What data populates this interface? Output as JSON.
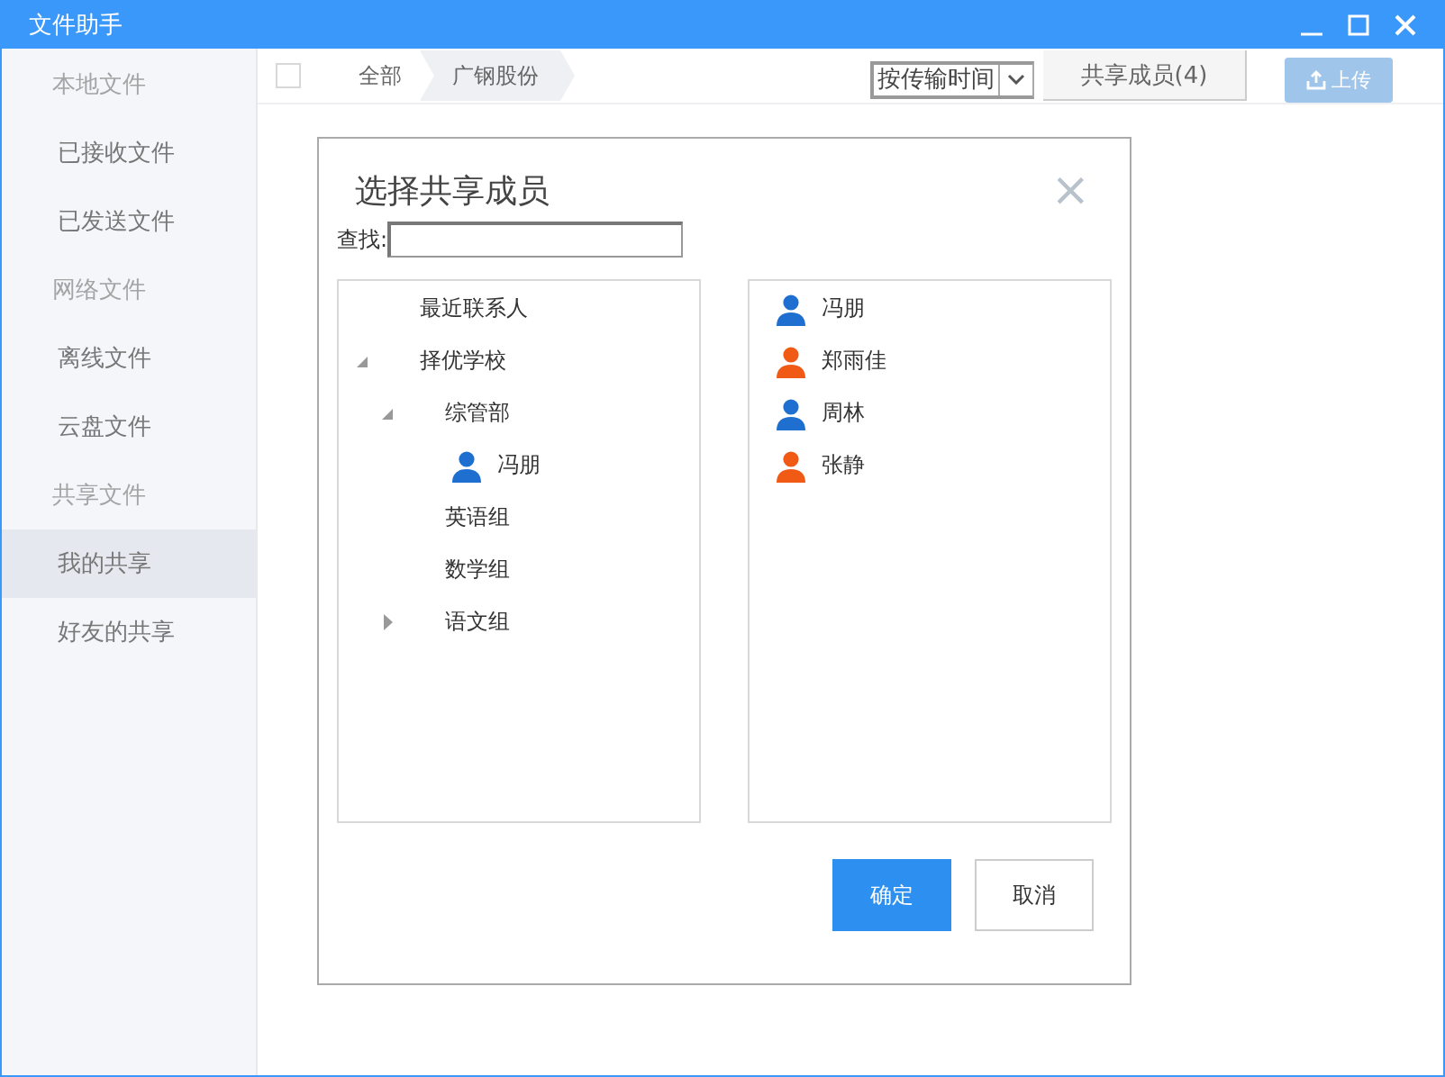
{
  "window": {
    "title": "文件助手"
  },
  "sidebar": {
    "sections": [
      {
        "header": "本地文件",
        "items": [
          {
            "label": "已接收文件",
            "selected": false
          },
          {
            "label": "已发送文件",
            "selected": false
          }
        ]
      },
      {
        "header": "网络文件",
        "items": [
          {
            "label": "离线文件",
            "selected": false
          },
          {
            "label": "云盘文件",
            "selected": false
          }
        ]
      },
      {
        "header": "共享文件",
        "items": [
          {
            "label": "我的共享",
            "selected": true
          },
          {
            "label": "好友的共享",
            "selected": false
          }
        ]
      }
    ]
  },
  "toolbar": {
    "select_all_checked": false,
    "breadcrumb": [
      {
        "label": "全部",
        "selected": false
      },
      {
        "label": "广钢股份",
        "selected": true
      }
    ],
    "sort": "按传输时间",
    "members_button": "共享成员(4)",
    "upload_button": {
      "label": "上传",
      "disabled": true
    }
  },
  "dialog": {
    "title": "选择共享成员",
    "close": "×",
    "search": {
      "label": "查找:"
    },
    "tree": [
      {
        "label": "最近联系人",
        "kind": "group"
      },
      {
        "label": "择优学校",
        "kind": "group",
        "expanded": true,
        "children": [
          {
            "label": "综管部",
            "kind": "group",
            "expanded": true,
            "children": [
              {
                "label": "冯朋",
                "kind": "person",
                "color": "#1f6fd0"
              }
            ]
          },
          {
            "label": "英语组",
            "kind": "group"
          },
          {
            "label": "数学组",
            "kind": "group"
          },
          {
            "label": "语文组",
            "kind": "group",
            "expanded": false
          }
        ]
      }
    ],
    "members": [
      {
        "name": "冯朋",
        "color": "#1f6fd0"
      },
      {
        "name": "郑雨佳",
        "color": "#f05a14"
      },
      {
        "name": "周林",
        "color": "#1f6fd0"
      },
      {
        "name": "张静",
        "color": "#f05a14"
      }
    ],
    "buttons": [
      {
        "label": "确定",
        "kind": "primary"
      },
      {
        "label": "取消",
        "kind": "secondary"
      }
    ]
  }
}
